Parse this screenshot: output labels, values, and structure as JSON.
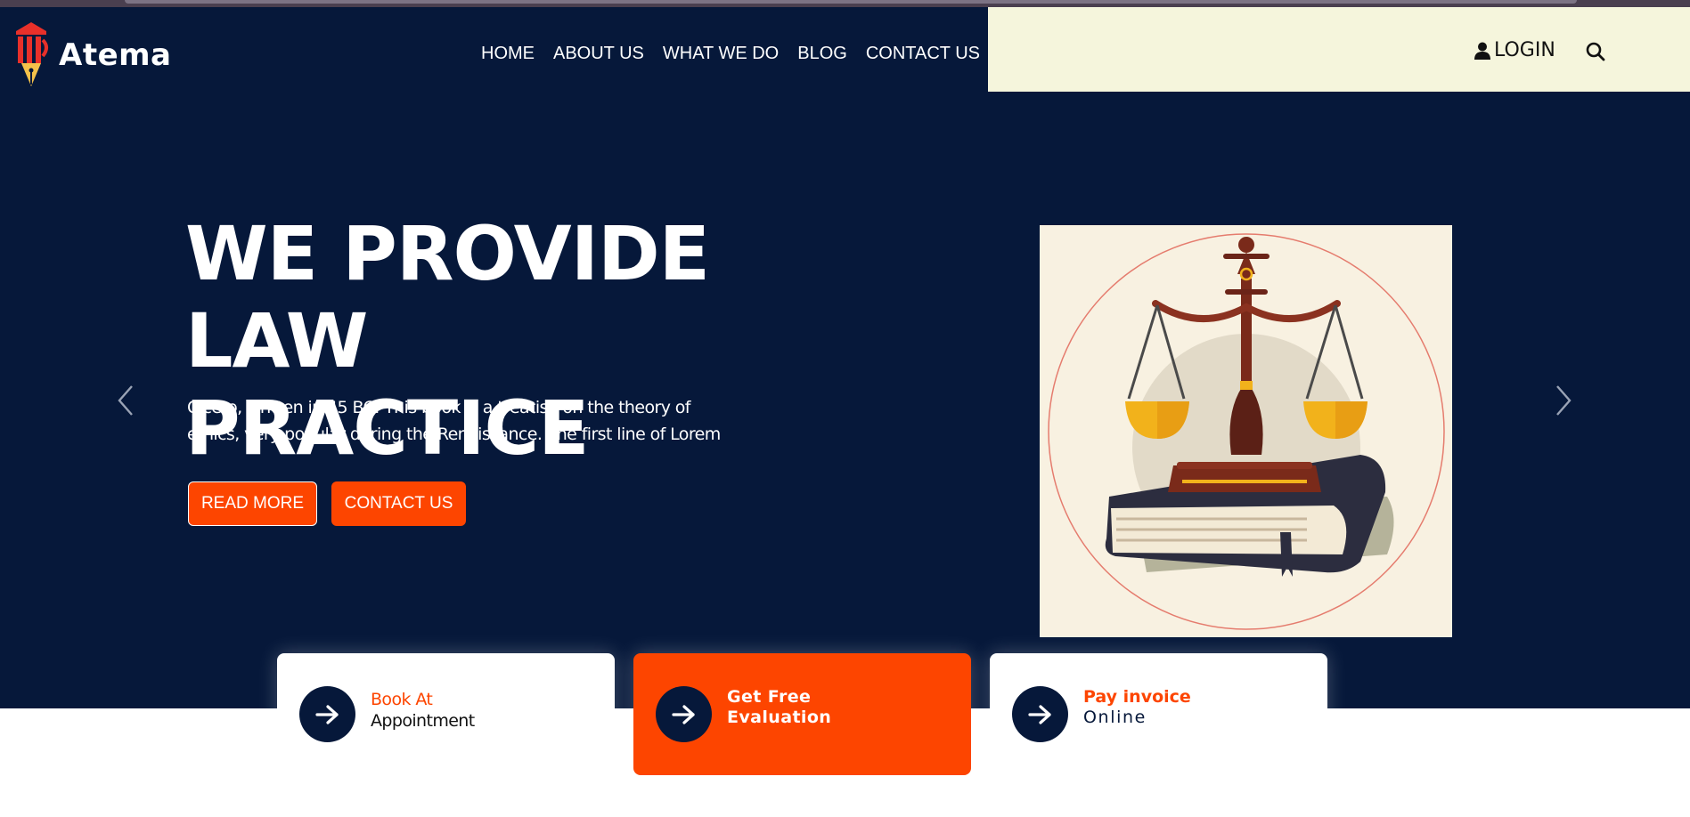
{
  "brand": {
    "name": "Atema",
    "logo_icon": "pillar-pen-icon",
    "colors": {
      "navy": "#06183a",
      "accent": "#fd4500",
      "util_bar": "#f5f5dc",
      "logo_red": "#e8302a",
      "logo_gold": "#f4c24a"
    }
  },
  "nav": {
    "items": [
      {
        "label": "HOME"
      },
      {
        "label": "ABOUT US"
      },
      {
        "label": "WHAT WE DO"
      },
      {
        "label": "BLOG"
      },
      {
        "label": "CONTACT US"
      }
    ]
  },
  "utility": {
    "login_label": "LOGIN",
    "login_icon": "user-icon",
    "search_icon": "search-icon"
  },
  "hero": {
    "title_line1": "WE PROVIDE LAW",
    "title_line2": "PRACTICE",
    "desc_line1": "Cicero, written in 45 BC. This book is a treatise on the theory of",
    "desc_line2": "ethics, very popular during the Renaissance. The first line of Lorem",
    "read_more_label": "READ MORE",
    "contact_label": "CONTACT US",
    "prev_icon": "chevron-left-icon",
    "next_icon": "chevron-right-icon",
    "illustration": "scales-of-justice-on-book"
  },
  "cards": [
    {
      "line1": "Book At",
      "line2": "Appointment",
      "icon": "arrow-right-icon"
    },
    {
      "line1": "Get Free",
      "line2": "Evaluation",
      "icon": "arrow-right-icon"
    },
    {
      "line1": "Pay invoice",
      "line2": "Online",
      "icon": "arrow-right-icon"
    }
  ]
}
